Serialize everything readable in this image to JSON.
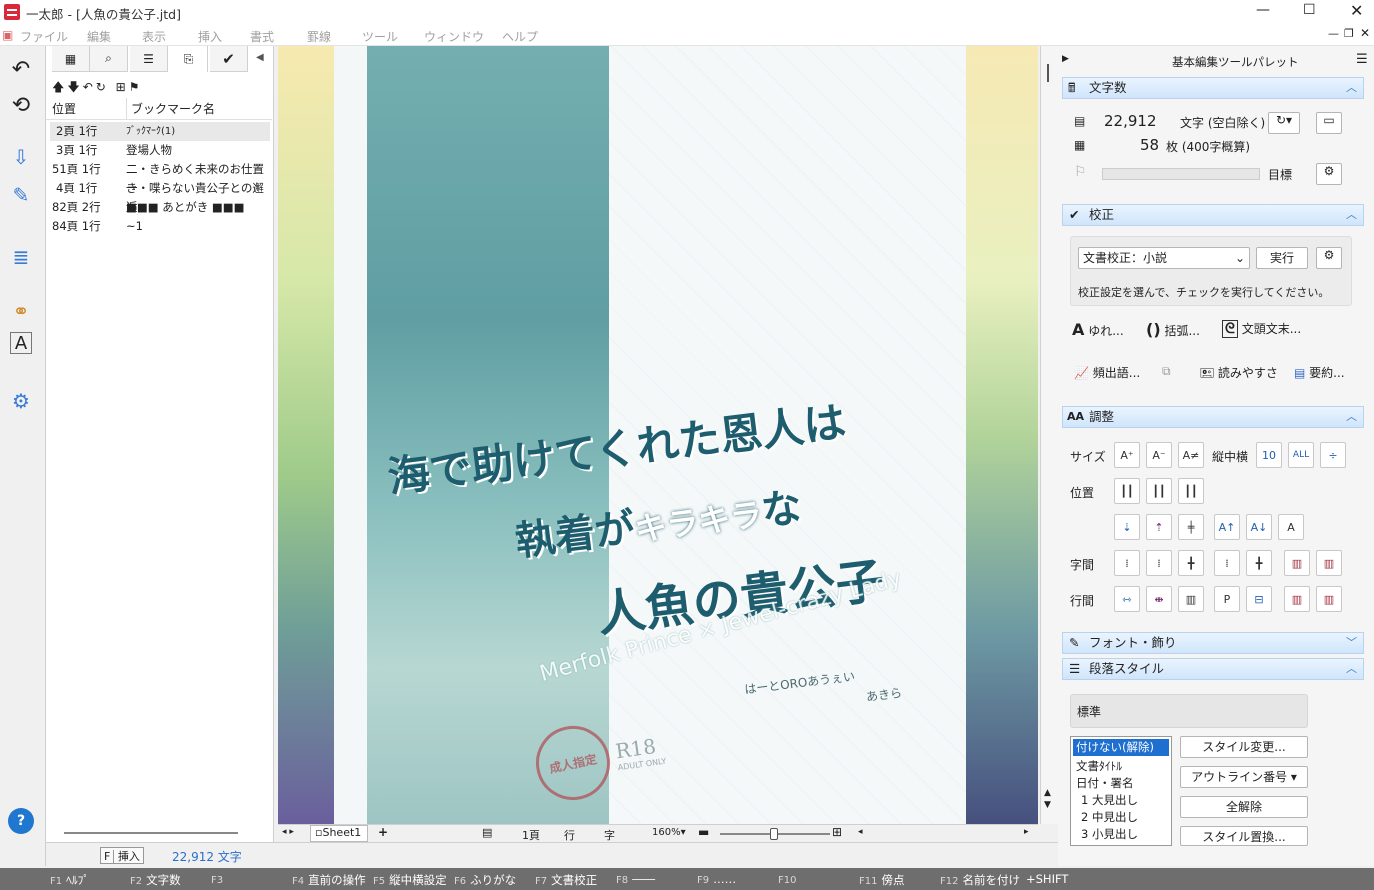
{
  "window": {
    "title": "一太郎 - [人魚の貴公子.jtd]"
  },
  "menu": [
    "ファイル",
    "編集",
    "表示",
    "挿入",
    "書式",
    "罫線",
    "ツール",
    "ウィンドウ",
    "ヘルプ"
  ],
  "bookmarks": {
    "headers": [
      "位置",
      "ブックマーク名"
    ],
    "rows": [
      {
        "pos": "2頁 1行",
        "name": "ﾌﾞｯｸﾏｰｸ(1)"
      },
      {
        "pos": "3頁 1行",
        "name": "登場人物"
      },
      {
        "pos": "51頁 1行",
        "name": "二・きらめく未来のお仕置き"
      },
      {
        "pos": "4頁 1行",
        "name": "一・喋らない貴公子との邂逅"
      },
      {
        "pos": "82頁 2行",
        "name": "■■■ あとがき ■■■"
      },
      {
        "pos": "84頁 1行",
        "name": "~1"
      }
    ]
  },
  "cover": {
    "title_line1": "海で助けてくれた恩人は",
    "title_line2": "執着が",
    "title_accent": "キラキラ",
    "title_line2b": "な",
    "title_line3": "人魚の貴公子",
    "subtitle": "Merfolk Prince × Jewel-crazy Lady",
    "author1": "はーとOROあうぇい",
    "author2": "あきら",
    "stamp": "成人指定",
    "rating": "R18",
    "rating_sub": "ADULT ONLY"
  },
  "palette": {
    "title": "基本編集ツールパレット",
    "charcount": {
      "header": "文字数",
      "chars": "22,912",
      "chars_label": "文字 (空白除く)",
      "pages": "58",
      "pages_label": "枚 (400字概算)",
      "goal": "目標"
    },
    "proof": {
      "header": "校正",
      "select": "文書校正：小説",
      "run": "実行",
      "hint": "校正設定を選んで、チェックを実行してください。",
      "tools": [
        "ゆれ...",
        "括弧...",
        "文頭文末..."
      ],
      "tools2": [
        "頻出語...",
        "読みやすさ",
        "要約..."
      ]
    },
    "adjust": {
      "header": "調整",
      "rows": [
        "サイズ",
        "位置",
        "字間",
        "行間"
      ],
      "tatechuyoko": "縦中横"
    },
    "font": {
      "header": "フォント・飾り"
    },
    "para": {
      "header": "段落スタイル",
      "current": "標準",
      "styles": [
        "付けない(解除)",
        "文書ﾀｲﾄﾙ",
        "日付・署名",
        "1 大見出し",
        "2 中見出し",
        "3 小見出し"
      ],
      "btns": [
        "スタイル変更...",
        "アウトライン番号",
        "全解除",
        "スタイル置換..."
      ]
    }
  },
  "status": {
    "sheet": "Sheet1",
    "mode": "挿入",
    "mode_key": "F",
    "chars": "22,912 文字",
    "page": "1頁",
    "line": "行",
    "char": "字",
    "zoom": "160%"
  },
  "fkeys": [
    {
      "k": "F1",
      "l": "ﾍﾙﾌﾟ"
    },
    {
      "k": "F2",
      "l": "文字数"
    },
    {
      "k": "F3",
      "l": ""
    },
    {
      "k": "F4",
      "l": "直前の操作"
    },
    {
      "k": "F5",
      "l": "縦中横設定"
    },
    {
      "k": "F6",
      "l": "ふりがな"
    },
    {
      "k": "F7",
      "l": "文書校正"
    },
    {
      "k": "F8",
      "l": "――"
    },
    {
      "k": "F9",
      "l": "……"
    },
    {
      "k": "F10",
      "l": ""
    },
    {
      "k": "F11",
      "l": "傍点"
    },
    {
      "k": "F12",
      "l": "名前を付け"
    },
    {
      "k": "",
      "l": "+SHIFT"
    }
  ]
}
